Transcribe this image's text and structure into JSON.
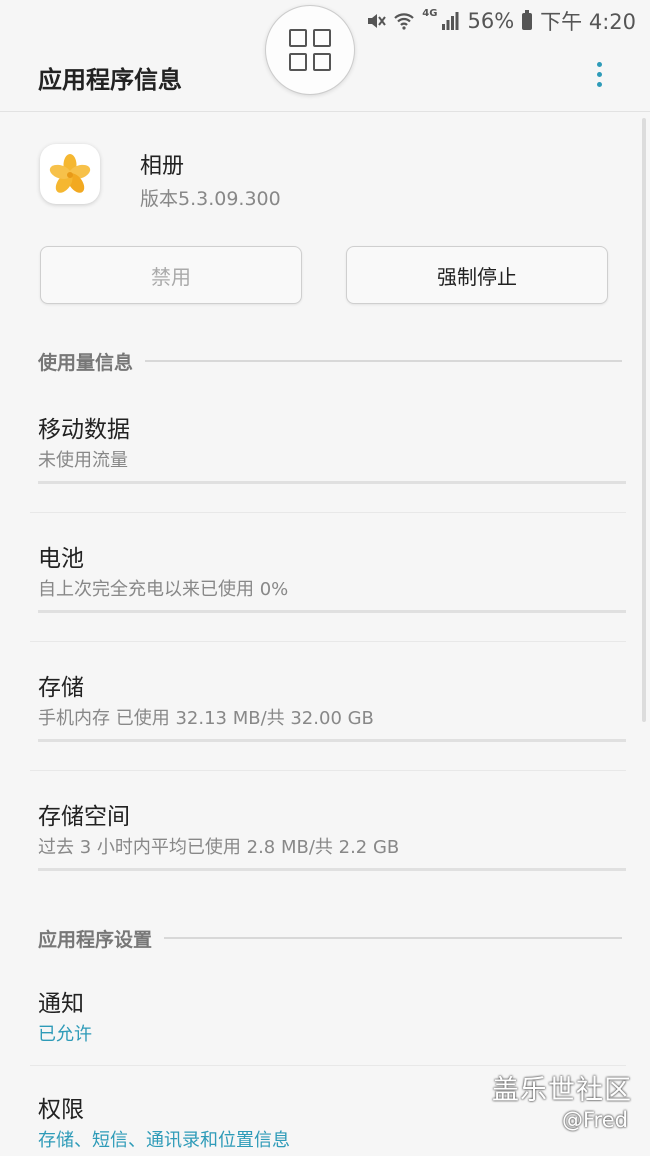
{
  "status_bar": {
    "network": "4G",
    "battery_percent": "56%",
    "time": "下午 4:20"
  },
  "header": {
    "title": "应用程序信息"
  },
  "app": {
    "name": "相册",
    "version": "版本5.3.09.300",
    "icon": "flower-icon"
  },
  "buttons": {
    "disable_label": "禁用",
    "force_stop_label": "强制停止"
  },
  "usage_section": {
    "title": "使用量信息",
    "items": [
      {
        "title": "移动数据",
        "subtitle": "未使用流量"
      },
      {
        "title": "电池",
        "subtitle": "自上次完全充电以来已使用 0%"
      },
      {
        "title": "存储",
        "subtitle": "手机内存 已使用 32.13 MB/共 32.00 GB"
      },
      {
        "title": "存储空间",
        "subtitle": "过去 3 小时内平均已使用 2.8 MB/共 2.2 GB"
      }
    ]
  },
  "settings_section": {
    "title": "应用程序设置",
    "items": [
      {
        "title": "通知",
        "subtitle": "已允许"
      },
      {
        "title": "权限",
        "subtitle": "存储、短信、通讯录和位置信息"
      }
    ]
  },
  "watermark": {
    "title": "盖乐世社区",
    "user": "@Fred"
  },
  "colors": {
    "accent": "#2e9bb8",
    "background": "#f6f6f6",
    "icon_yellow": "#f5b731"
  }
}
